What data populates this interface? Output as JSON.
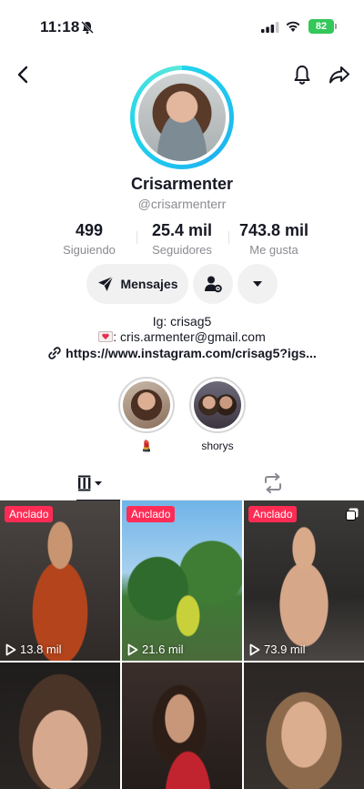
{
  "status_bar": {
    "time": "11:18",
    "battery": "82"
  },
  "profile": {
    "display_name": "Crisarmenter",
    "username": "@crisarmenterr"
  },
  "stats": [
    {
      "value": "499",
      "label": "Siguiendo"
    },
    {
      "value": "25.4 mil",
      "label": "Seguidores"
    },
    {
      "value": "743.8 mil",
      "label": "Me gusta"
    }
  ],
  "actions": {
    "message_label": "Mensajes"
  },
  "bio": {
    "line1": "Ig: crisag5",
    "line2": ": cris.armenter@gmail.com",
    "link": "https://www.instagram.com/crisag5?igs..."
  },
  "highlights": [
    {
      "label": "💄"
    },
    {
      "label": "shorys"
    }
  ],
  "videos": [
    {
      "badge": "Anclado",
      "views": "13.8 mil"
    },
    {
      "badge": "Anclado",
      "views": "21.6 mil"
    },
    {
      "badge": "Anclado",
      "views": "73.9 mil"
    },
    {
      "badge": "",
      "views": ""
    },
    {
      "badge": "",
      "views": ""
    },
    {
      "badge": "",
      "views": ""
    }
  ],
  "colors": {
    "accent": "#fe2c55",
    "ring": "#20d5ec",
    "battery": "#34c759"
  }
}
